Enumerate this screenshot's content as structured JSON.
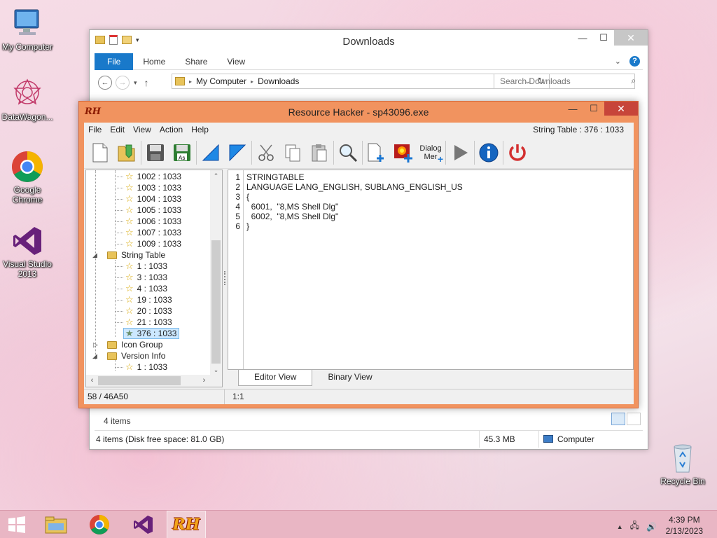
{
  "desktop": {
    "icons": [
      {
        "label": "My Computer"
      },
      {
        "label": "DataWagon..."
      },
      {
        "label": "Google Chrome"
      },
      {
        "label": "Visual Studio 2013"
      },
      {
        "label": "Recycle Bin"
      }
    ]
  },
  "explorer": {
    "title": "Downloads",
    "ribbon_tabs": [
      "File",
      "Home",
      "Share",
      "View"
    ],
    "breadcrumb": [
      "My Computer",
      "Downloads"
    ],
    "search_placeholder": "Search Downloads",
    "item_count": "4 items",
    "status_left": "4 items (Disk free space: 81.0 GB)",
    "status_size": "45.3 MB",
    "status_location": "Computer"
  },
  "rh": {
    "logo": "RH",
    "title": "Resource Hacker - sp43096.exe",
    "menu": [
      "File",
      "Edit",
      "View",
      "Action",
      "Help"
    ],
    "resource_id": "String Table : 376 : 1033",
    "toolbar_dialog_label_1": "Dialog",
    "toolbar_dialog_label_2": "Mer",
    "tree": {
      "top_items": [
        "1002 : 1033",
        "1003 : 1033",
        "1004 : 1033",
        "1005 : 1033",
        "1006 : 1033",
        "1007 : 1033",
        "1009 : 1033"
      ],
      "string_table_label": "String Table",
      "string_table_items": [
        "1 : 1033",
        "3 : 1033",
        "4 : 1033",
        "19 : 1033",
        "20 : 1033",
        "21 : 1033",
        "376 : 1033"
      ],
      "icon_group_label": "Icon Group",
      "version_info_label": "Version Info",
      "version_info_items": [
        "1 : 1033"
      ]
    },
    "editor": {
      "line_numbers": [
        "1",
        "2",
        "3",
        "4",
        "5",
        "6"
      ],
      "lines": [
        "STRINGTABLE",
        "LANGUAGE LANG_ENGLISH, SUBLANG_ENGLISH_US",
        "{",
        "  6001,  \"8,MS Shell Dlg\"",
        "  6002,  \"8,MS Shell Dlg\"",
        "}"
      ]
    },
    "tabs": [
      "Editor View",
      "Binary View"
    ],
    "status_offset": "58 / 46A50",
    "status_cursor": "1:1"
  },
  "taskbar": {
    "time": "4:39 PM",
    "date": "2/13/2023",
    "rh_label": "RH"
  }
}
